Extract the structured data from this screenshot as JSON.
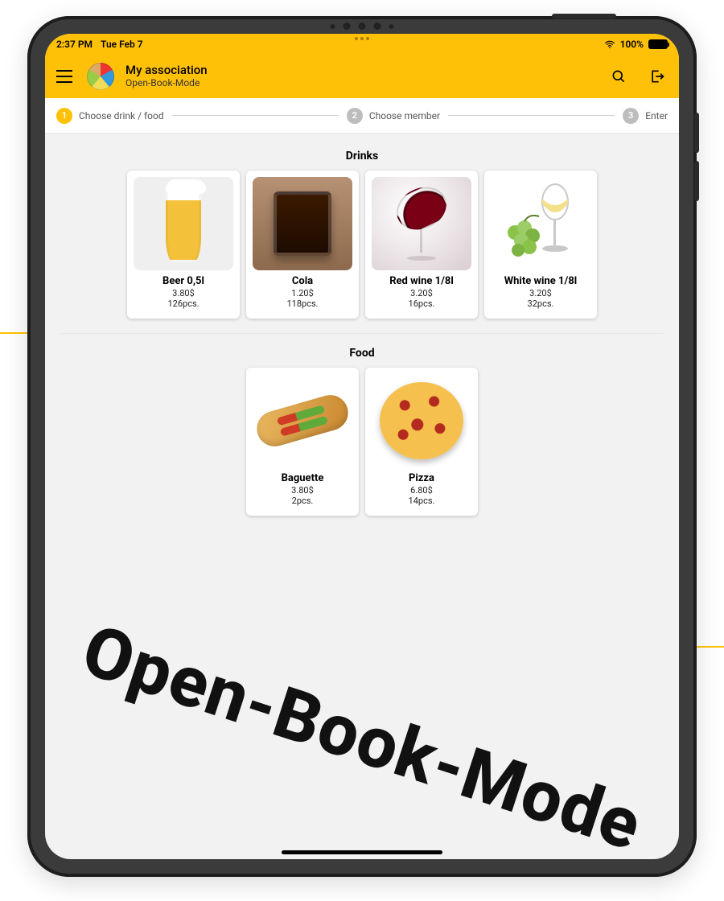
{
  "statusbar": {
    "time": "2:37 PM",
    "date": "Tue Feb 7",
    "battery_pct": "100%"
  },
  "appbar": {
    "title": "My association",
    "subtitle": "Open-Book-Mode"
  },
  "stepper": {
    "step1": "Choose drink / food",
    "step2": "Choose member",
    "step3": "Enter"
  },
  "sections": {
    "drinks_title": "Drinks",
    "food_title": "Food"
  },
  "drinks": [
    {
      "name": "Beer 0,5l",
      "price": "3.80$",
      "stock": "126pcs."
    },
    {
      "name": "Cola",
      "price": "1.20$",
      "stock": "118pcs."
    },
    {
      "name": "Red wine 1/8l",
      "price": "3.20$",
      "stock": "16pcs."
    },
    {
      "name": "White wine 1/8l",
      "price": "3.20$",
      "stock": "32pcs."
    }
  ],
  "food": [
    {
      "name": "Baguette",
      "price": "3.80$",
      "stock": "2pcs."
    },
    {
      "name": "Pizza",
      "price": "6.80$",
      "stock": "14pcs."
    }
  ],
  "watermark": "Open-Book-Mode"
}
